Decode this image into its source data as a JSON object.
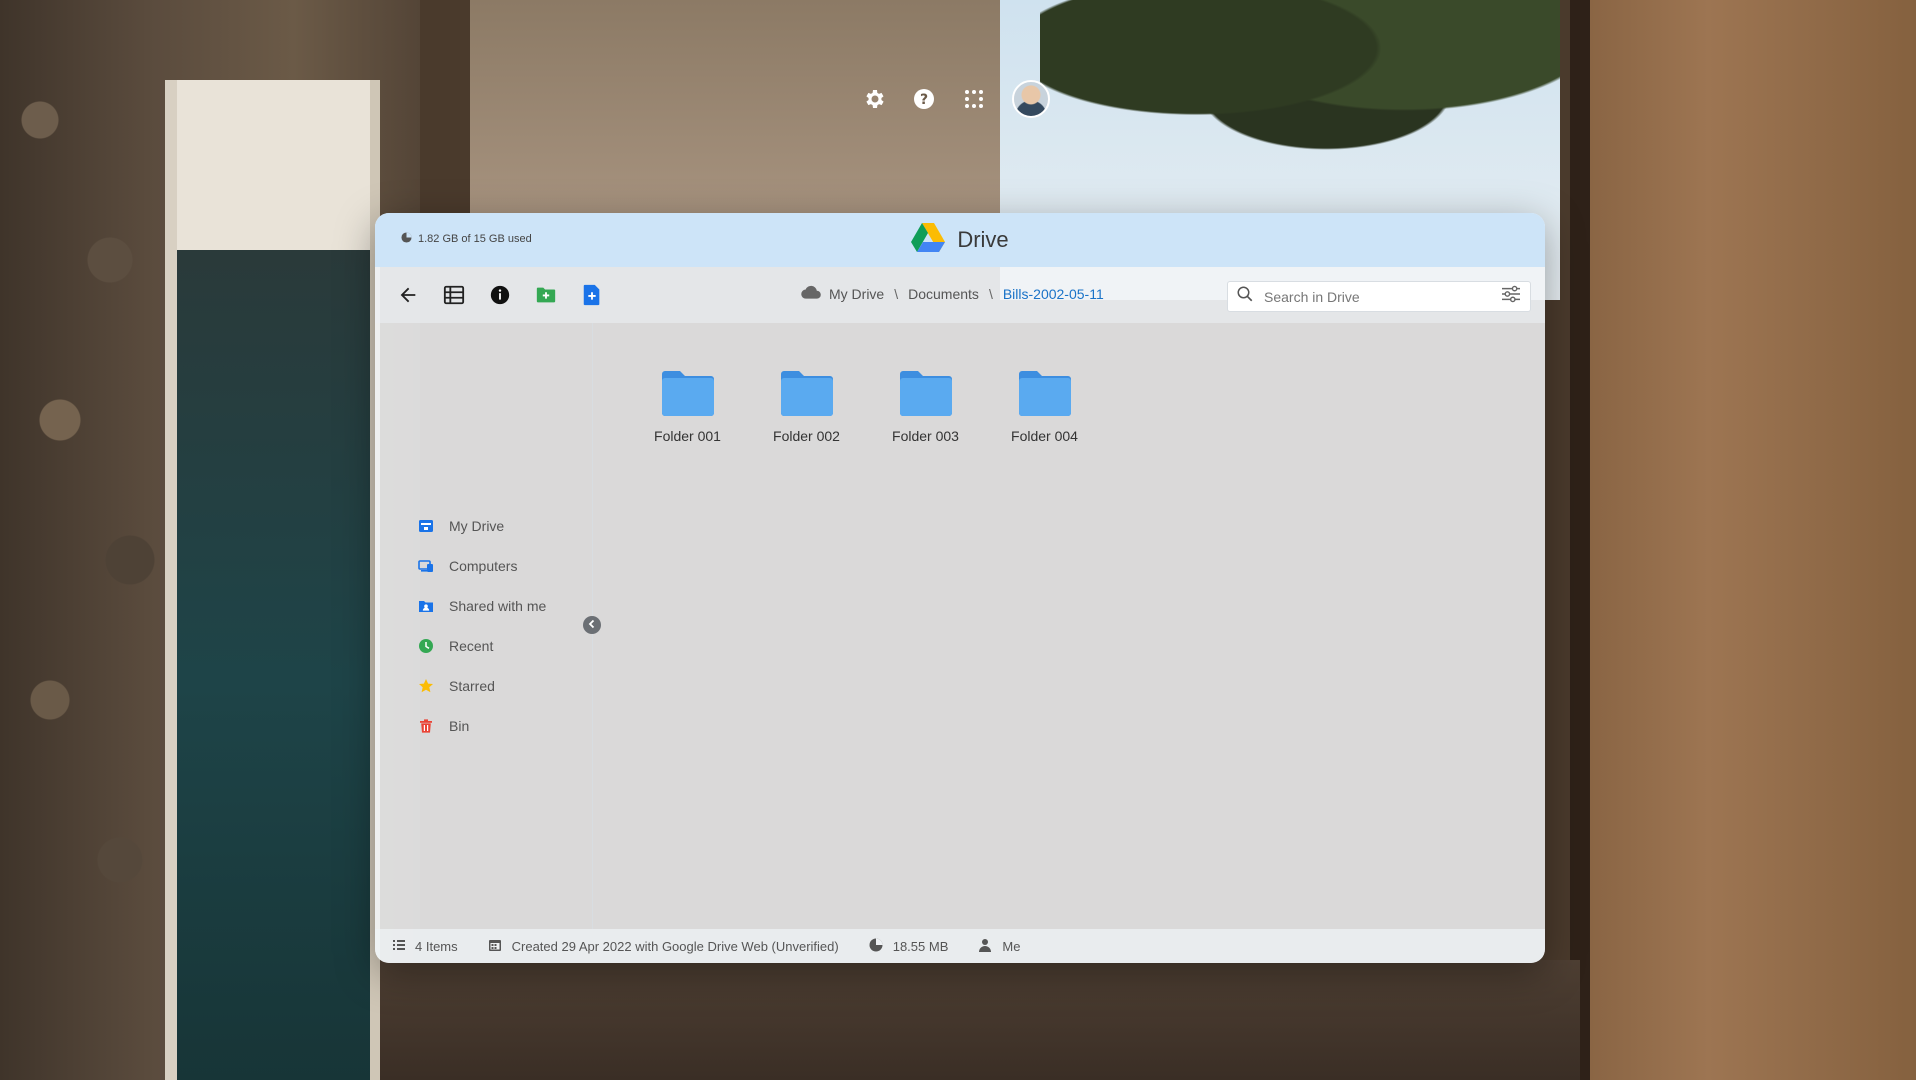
{
  "shell": {
    "icons": [
      "gear-icon",
      "help-icon",
      "apps-grid-icon",
      "avatar"
    ]
  },
  "window": {
    "title": "Drive",
    "storage_text": "1.82 GB of 15 GB used"
  },
  "toolbar": {
    "tools": [
      "back-arrow-icon",
      "list-view-icon",
      "info-icon",
      "new-folder-icon",
      "new-file-icon"
    ]
  },
  "breadcrumb": {
    "items": [
      "My Drive",
      "Documents",
      "Bills-2002-05-11"
    ],
    "separator": "\\"
  },
  "search": {
    "placeholder": "Search in Drive",
    "value": ""
  },
  "sidebar": {
    "items": [
      {
        "label": "My Drive",
        "icon": "my-drive-icon",
        "color": "#1a73e8"
      },
      {
        "label": "Computers",
        "icon": "computers-icon",
        "color": "#1a73e8"
      },
      {
        "label": "Shared with me",
        "icon": "shared-icon",
        "color": "#1a73e8"
      },
      {
        "label": "Recent",
        "icon": "clock-icon",
        "color": "#34a853"
      },
      {
        "label": "Starred",
        "icon": "star-icon",
        "color": "#fbbc04"
      },
      {
        "label": "Bin",
        "icon": "trash-icon",
        "color": "#ea4335"
      }
    ]
  },
  "folders": [
    {
      "name": "Folder 001"
    },
    {
      "name": "Folder 002"
    },
    {
      "name": "Folder 003"
    },
    {
      "name": "Folder 004"
    }
  ],
  "status": {
    "items_count": "4 Items",
    "created": "Created 29 Apr 2022 with Google Drive Web (Unverified)",
    "size": "18.55 MB",
    "owner": "Me"
  },
  "colors": {
    "titlebar": "#cde4f8",
    "folder": "#4a9fe8",
    "accent": "#1a73c8"
  }
}
